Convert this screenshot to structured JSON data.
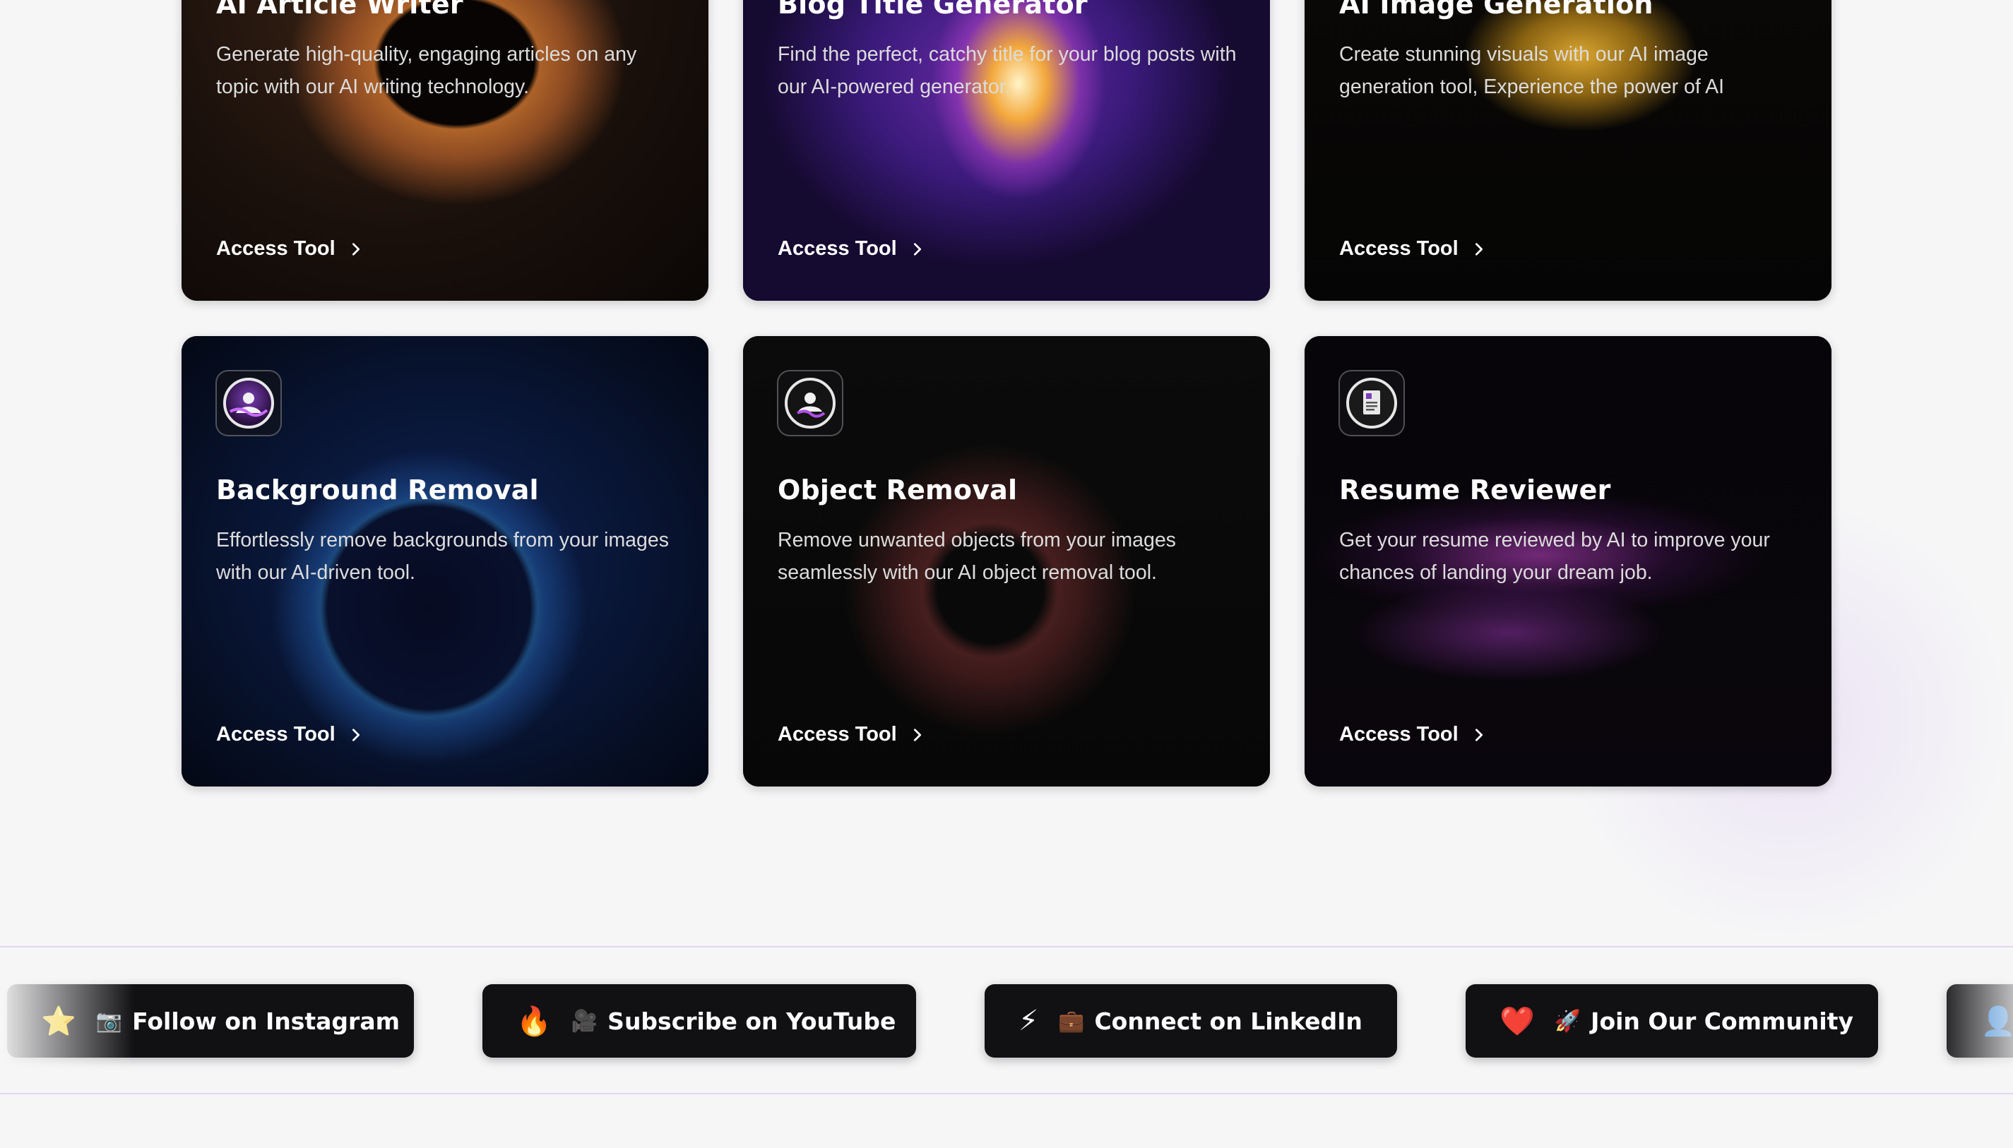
{
  "cards": [
    {
      "title": "AI Article Writer",
      "description": "Generate high-quality, engaging articles on any topic with our AI writing technology.",
      "link_label": "Access Tool"
    },
    {
      "title": "Blog Title Generator",
      "description": "Find the perfect, catchy title for your blog posts with our AI-powered generator.",
      "link_label": "Access Tool"
    },
    {
      "title": "AI Image Generation",
      "description": "Create stunning visuals with our AI image generation tool, Experience the power of AI",
      "link_label": "Access Tool"
    },
    {
      "title": "Background Removal",
      "description": "Effortlessly remove backgrounds from your images with our AI-driven tool.",
      "link_label": "Access Tool",
      "icon": "background-removal-icon"
    },
    {
      "title": "Object Removal",
      "description": "Remove unwanted objects from your images seamlessly with our AI object removal tool.",
      "link_label": "Access Tool",
      "icon": "object-removal-icon"
    },
    {
      "title": "Resume Reviewer",
      "description": "Get your resume reviewed by AI to improve your chances of landing your dream job.",
      "link_label": "Access Tool",
      "icon": "resume-icon"
    }
  ],
  "social_pills": [
    {
      "lead_emoji": "⭐",
      "icon_emoji": "📷",
      "label": "Follow on Instagram"
    },
    {
      "lead_emoji": "🔥",
      "icon_emoji": "🎥",
      "label": "Subscribe on YouTube"
    },
    {
      "lead_emoji": "⚡",
      "icon_emoji": "💼",
      "label": "Connect on LinkedIn"
    },
    {
      "lead_emoji": "❤️",
      "icon_emoji": "🚀",
      "label": "Join Our Community"
    },
    {
      "lead_emoji": "",
      "icon_emoji": "👤",
      "label": ""
    }
  ],
  "colors": {
    "page_bg": "#f6f6f7",
    "card_bg": "#060608",
    "pill_bg": "#111114",
    "accent_dot": "#b57cf0",
    "divider": "#e4d4f5"
  }
}
